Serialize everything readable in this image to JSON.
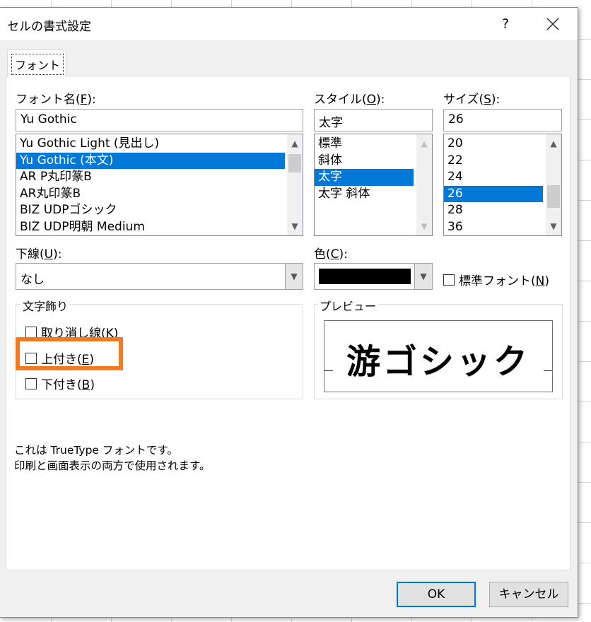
{
  "dialog": {
    "title": "セルの書式設定",
    "help_label": "?",
    "close_label": "✕"
  },
  "tabs": [
    {
      "label": "フォント",
      "active": true
    }
  ],
  "font_name": {
    "label_prefix": "フォント名(",
    "accel": "F",
    "label_suffix": "):",
    "value": "Yu Gothic",
    "items": [
      {
        "label": "Yu Gothic Light (見出し)",
        "selected": false
      },
      {
        "label": "Yu Gothic (本文)",
        "selected": true
      },
      {
        "label": "AR P丸印篆B",
        "selected": false
      },
      {
        "label": "AR丸印篆B",
        "selected": false
      },
      {
        "label": "BIZ UDPゴシック",
        "selected": false
      },
      {
        "label": "BIZ UDP明朝 Medium",
        "selected": false
      }
    ]
  },
  "style": {
    "label_prefix": "スタイル(",
    "accel": "O",
    "label_suffix": "):",
    "value": "太字",
    "items": [
      {
        "label": "標準",
        "selected": false
      },
      {
        "label": "斜体",
        "selected": false
      },
      {
        "label": "太字",
        "selected": true
      },
      {
        "label": "太字 斜体",
        "selected": false
      }
    ]
  },
  "size": {
    "label_prefix": "サイズ(",
    "accel": "S",
    "label_suffix": "):",
    "value": "26",
    "items": [
      {
        "label": "20",
        "selected": false
      },
      {
        "label": "22",
        "selected": false
      },
      {
        "label": "24",
        "selected": false
      },
      {
        "label": "26",
        "selected": true
      },
      {
        "label": "28",
        "selected": false
      },
      {
        "label": "36",
        "selected": false
      }
    ]
  },
  "underline": {
    "label_prefix": "下線(",
    "accel": "U",
    "label_suffix": "):",
    "value": "なし"
  },
  "color": {
    "label_prefix": "色(",
    "accel": "C",
    "label_suffix": "):",
    "value_hex": "#000000"
  },
  "normal_font": {
    "label_prefix": "標準フォント(",
    "accel": "N",
    "label_suffix": ")",
    "checked": false
  },
  "effects": {
    "title": "文字飾り",
    "strikethrough": {
      "label": "取り消し線(K)",
      "checked": false
    },
    "superscript": {
      "label_prefix": "上付き(",
      "accel": "E",
      "label_suffix": ")",
      "checked": false
    },
    "subscript": {
      "label_prefix": "下付き(",
      "accel": "B",
      "label_suffix": ")",
      "checked": false
    }
  },
  "highlight_color": "#f47a20",
  "preview": {
    "title": "プレビュー",
    "sample_text": "游ゴシック"
  },
  "info": {
    "line1": "これは TrueType フォントです。",
    "line2": "印刷と画面表示の両方で使用されます。"
  },
  "buttons": {
    "ok": "OK",
    "cancel": "キャンセル"
  },
  "icons": {
    "scroll_up": "⌃",
    "scroll_down": "⌄",
    "dropdown": "⌄"
  }
}
